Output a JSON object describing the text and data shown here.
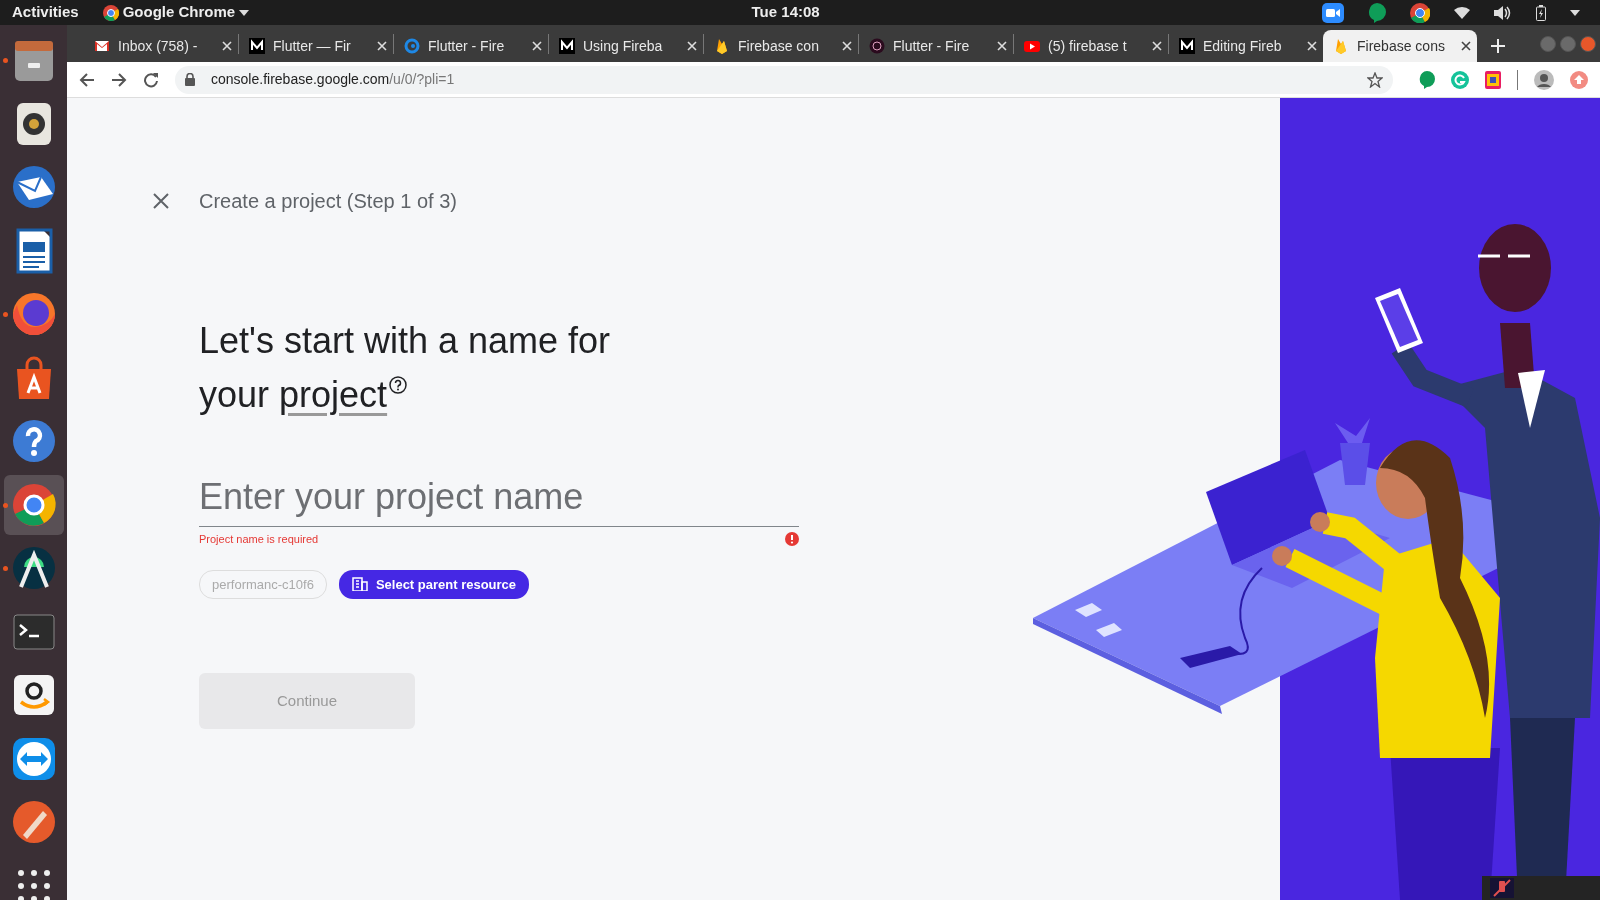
{
  "top_bar": {
    "activities": "Activities",
    "app_menu": "Google Chrome",
    "clock": "Tue 14:08"
  },
  "dock": [
    {
      "kind": "drawer",
      "running": true,
      "selected": false
    },
    {
      "kind": "speaker",
      "running": false,
      "selected": false
    },
    {
      "kind": "mail",
      "running": false,
      "selected": false
    },
    {
      "kind": "document",
      "running": false,
      "selected": false
    },
    {
      "kind": "firefox",
      "running": true,
      "selected": false
    },
    {
      "kind": "bag",
      "running": false,
      "selected": false
    },
    {
      "kind": "help",
      "running": false,
      "selected": false
    },
    {
      "kind": "chrome",
      "running": true,
      "selected": true
    },
    {
      "kind": "robot",
      "running": true,
      "selected": false
    },
    {
      "kind": "terminal",
      "running": false,
      "selected": false
    },
    {
      "kind": "smile",
      "running": false,
      "selected": false
    },
    {
      "kind": "remote",
      "running": false,
      "selected": false
    },
    {
      "kind": "pen",
      "running": false,
      "selected": false
    },
    {
      "kind": "grid",
      "running": false,
      "selected": false
    }
  ],
  "tabs": [
    {
      "kind": "envelope",
      "label": "Inbox (758) -",
      "selected": false
    },
    {
      "kind": "zigzag",
      "label": "Flutter — Fir",
      "selected": false
    },
    {
      "kind": "ring",
      "label": "Flutter - Fire",
      "selected": false
    },
    {
      "kind": "zigzag",
      "label": "Using Fireba",
      "selected": false
    },
    {
      "kind": "flame",
      "label": "Firebase con",
      "selected": false
    },
    {
      "kind": "dot",
      "label": "Flutter - Fire",
      "selected": false
    },
    {
      "kind": "play",
      "label": "(5) firebase t",
      "selected": false
    },
    {
      "kind": "zigzag",
      "label": "Editing Fireb",
      "selected": false
    },
    {
      "kind": "flame",
      "label": "Firebase cons",
      "selected": true
    }
  ],
  "address_bar": {
    "host": "console.firebase.google.com",
    "path": "/u/0/?pli=1"
  },
  "page": {
    "title": "Create a project (Step 1 of 3)",
    "heading": "Let's start with a name for your ",
    "heading_link": "project",
    "project_name": {
      "placeholder": "Enter your project name",
      "invalid": true,
      "error": "Project name is required"
    },
    "project_id": "performanc-c10f6",
    "parent_button": "Select parent resource",
    "continue_button": {
      "label": "Continue",
      "disabled": true
    }
  }
}
